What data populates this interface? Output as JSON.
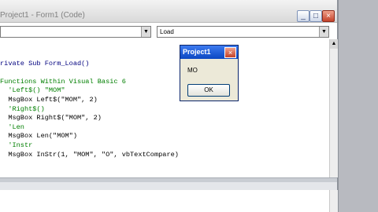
{
  "window": {
    "title": "Project1 - Form1 (Code)",
    "min_label": "_",
    "max_label": "□",
    "close_label": "×"
  },
  "toolbar": {
    "object_combo_value": "",
    "procedure_combo_value": "Load",
    "dropdown_arrow": "▼"
  },
  "code": {
    "lines": [
      "rivate Sub Form_Load()",
      "",
      "Functions Within Visual Basic 6",
      "  'Left$() \"MOM\"",
      "  MsgBox Left$(\"MOM\", 2)",
      "  'Right$()",
      "  MsgBox Right$(\"MOM\", 2)",
      "  'Len",
      "  MsgBox Len(\"MOM\")",
      "  'Instr",
      "  MsgBox InStr(1, \"MOM\", \"O\", vbTextCompare)"
    ]
  },
  "msgbox": {
    "title": "Project1",
    "message": "MO",
    "ok_label": "OK",
    "close_label": "×"
  },
  "scrollbar": {
    "up_arrow": "▲"
  }
}
